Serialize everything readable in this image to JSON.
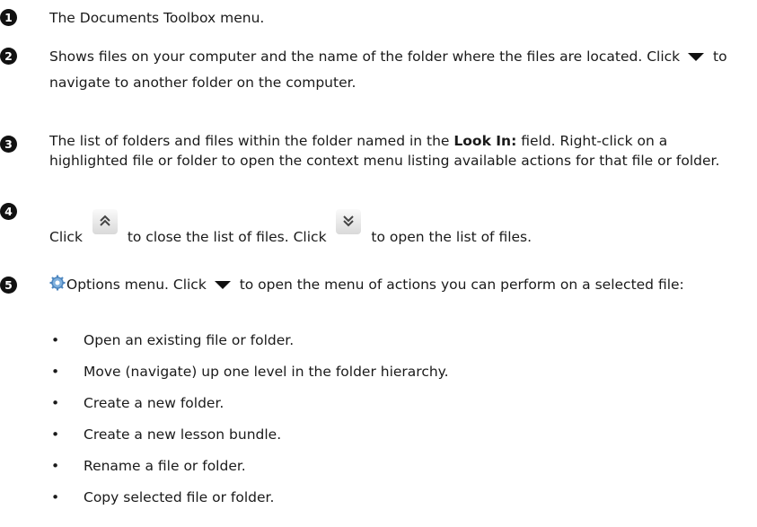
{
  "items": [
    {
      "num": "1",
      "text": "The Documents Toolbox menu."
    },
    {
      "num": "2",
      "text_a": "Shows files on your computer and the name of the folder where the files are located. Click",
      "text_b": "to navigate to another folder on the computer."
    },
    {
      "num": "3",
      "text_a": "The list of folders and files within the folder named in the",
      "bold": "Look In:",
      "text_b": "field. Right-click on a highlighted file or folder to open the context menu listing available actions for that file or folder."
    },
    {
      "num": "4",
      "text_a": "Click",
      "text_b": "to close the list of files. Click",
      "text_c": "to open the list of files."
    },
    {
      "num": "5",
      "text_a": "Options menu. Click",
      "text_b": "to open the menu of actions you can perform on a selected file:"
    }
  ],
  "options": [
    "Open an existing file or folder.",
    "Move (navigate) up one level in the folder hierarchy.",
    "Create a new folder.",
    "Create a new lesson bundle.",
    "Rename a file or folder.",
    "Copy selected file or folder."
  ],
  "bullet": "•",
  "icons": [
    "dropdown-arrow-icon",
    "collapse-chevron-icon",
    "expand-chevron-icon",
    "gear-icon"
  ]
}
